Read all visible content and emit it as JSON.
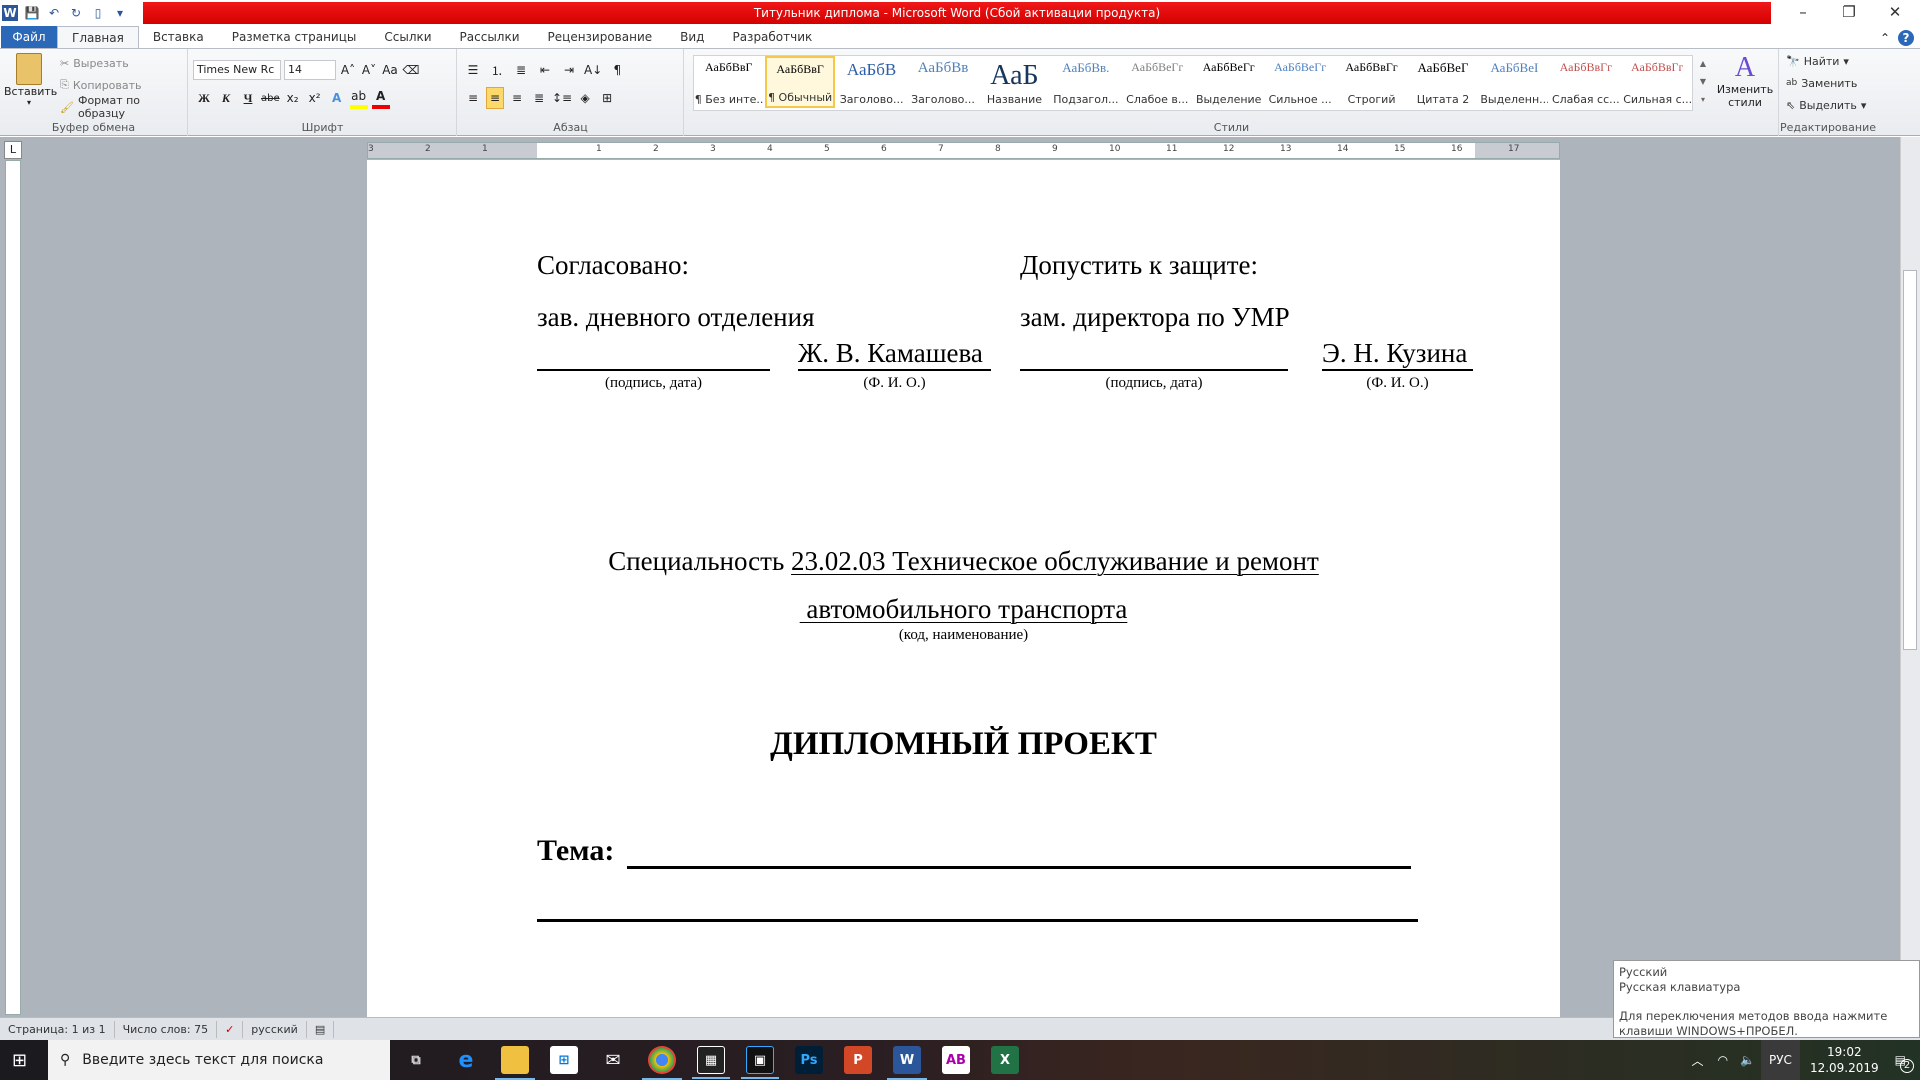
{
  "window": {
    "title": "Титульник диплома - Microsoft Word (Сбой активации продукта)",
    "minimize": "–",
    "restore": "❐",
    "close": "✕"
  },
  "tabs": [
    {
      "label": "Файл"
    },
    {
      "label": "Главная"
    },
    {
      "label": "Вставка"
    },
    {
      "label": "Разметка страницы"
    },
    {
      "label": "Ссылки"
    },
    {
      "label": "Рассылки"
    },
    {
      "label": "Рецензирование"
    },
    {
      "label": "Вид"
    },
    {
      "label": "Разработчик"
    }
  ],
  "clipboard": {
    "paste": "Вставить",
    "cut": "Вырезать",
    "copy": "Копировать",
    "format_painter": "Формат по образцу",
    "label": "Буфер обмена"
  },
  "font": {
    "name": "Times New Rc",
    "size": "14",
    "label": "Шрифт",
    "bold": "Ж",
    "italic": "К",
    "underline": "Ч",
    "strike": "abe",
    "sub": "x₂",
    "sup": "x²",
    "grow": "A˄",
    "shrink": "A˅",
    "case": "Aa"
  },
  "paragraph": {
    "label": "Абзац",
    "pilcrow": "¶"
  },
  "styles": {
    "label": "Стили",
    "change": "Изменить стили",
    "items": [
      {
        "preview": "АаБбВвГ",
        "name": "¶ Без инте..."
      },
      {
        "preview": "АаБбВвГ",
        "name": "¶ Обычный",
        "selected": true
      },
      {
        "preview": "АаБбВ",
        "name": "Заголово..."
      },
      {
        "preview": "АаБбВв",
        "name": "Заголово..."
      },
      {
        "preview": "АаБ",
        "name": "Название"
      },
      {
        "preview": "АаБбВв.",
        "name": "Подзагол..."
      },
      {
        "preview": "АаБбВеГг",
        "name": "Слабое в..."
      },
      {
        "preview": "АаБбВеГг",
        "name": "Выделение"
      },
      {
        "preview": "АаБбВеГг",
        "name": "Сильное ..."
      },
      {
        "preview": "АаБбВвГг",
        "name": "Строгий"
      },
      {
        "preview": "АаБбВеГ",
        "name": "Цитата 2"
      },
      {
        "preview": "АаБбВеI",
        "name": "Выделенн..."
      },
      {
        "preview": "АаБбВвГг",
        "name": "Слабая сс..."
      },
      {
        "preview": "АаБбВвГг",
        "name": "Сильная с..."
      }
    ]
  },
  "editing": {
    "label": "Редактирование",
    "find": "Найти",
    "replace": "Заменить",
    "select": "Выделить"
  },
  "ruler": {
    "ticks": [
      "3",
      "2",
      "1",
      "",
      "1",
      "2",
      "3",
      "4",
      "5",
      "6",
      "7",
      "8",
      "9",
      "10",
      "11",
      "12",
      "13",
      "14",
      "15",
      "16",
      "17"
    ]
  },
  "document": {
    "agreed": "Согласовано:",
    "admit": "Допустить к защите:",
    "left_position": "зав. дневного отделения",
    "right_position": "зам. директора по УМР",
    "left_name": "Ж. В. Камашева",
    "right_name": "Э. Н. Кузина",
    "sign_caption": "(подпись, дата)",
    "fio_caption": "(Ф. И. О.)",
    "specialty_label": "Специальность ",
    "specialty_value_1": "23.02.03 Техническое обслуживание и ремонт",
    "specialty_value_2": " автомобильного транспорта",
    "specialty_caption": "(код, наименование)",
    "heading": "ДИПЛОМНЫЙ ПРОЕКТ",
    "topic_label": "Тема:"
  },
  "status": {
    "page": "Страница: 1 из 1",
    "words": "Число слов: 75",
    "language": "русский"
  },
  "taskbar": {
    "search_placeholder": "Введите здесь текст для поиска",
    "time": "19:02",
    "date": "12.09.2019",
    "lang": "РУС",
    "notifications": "2"
  },
  "tooltip": {
    "line1": "Русский",
    "line2": "Русская клавиатура",
    "line3": "Для переключения методов ввода нажмите клавиши WINDOWS+ПРОБЕЛ."
  },
  "colors": {
    "titlebar": "#e00000",
    "file_tab": "#2b68b8",
    "taskbar": "#1f1f24"
  }
}
